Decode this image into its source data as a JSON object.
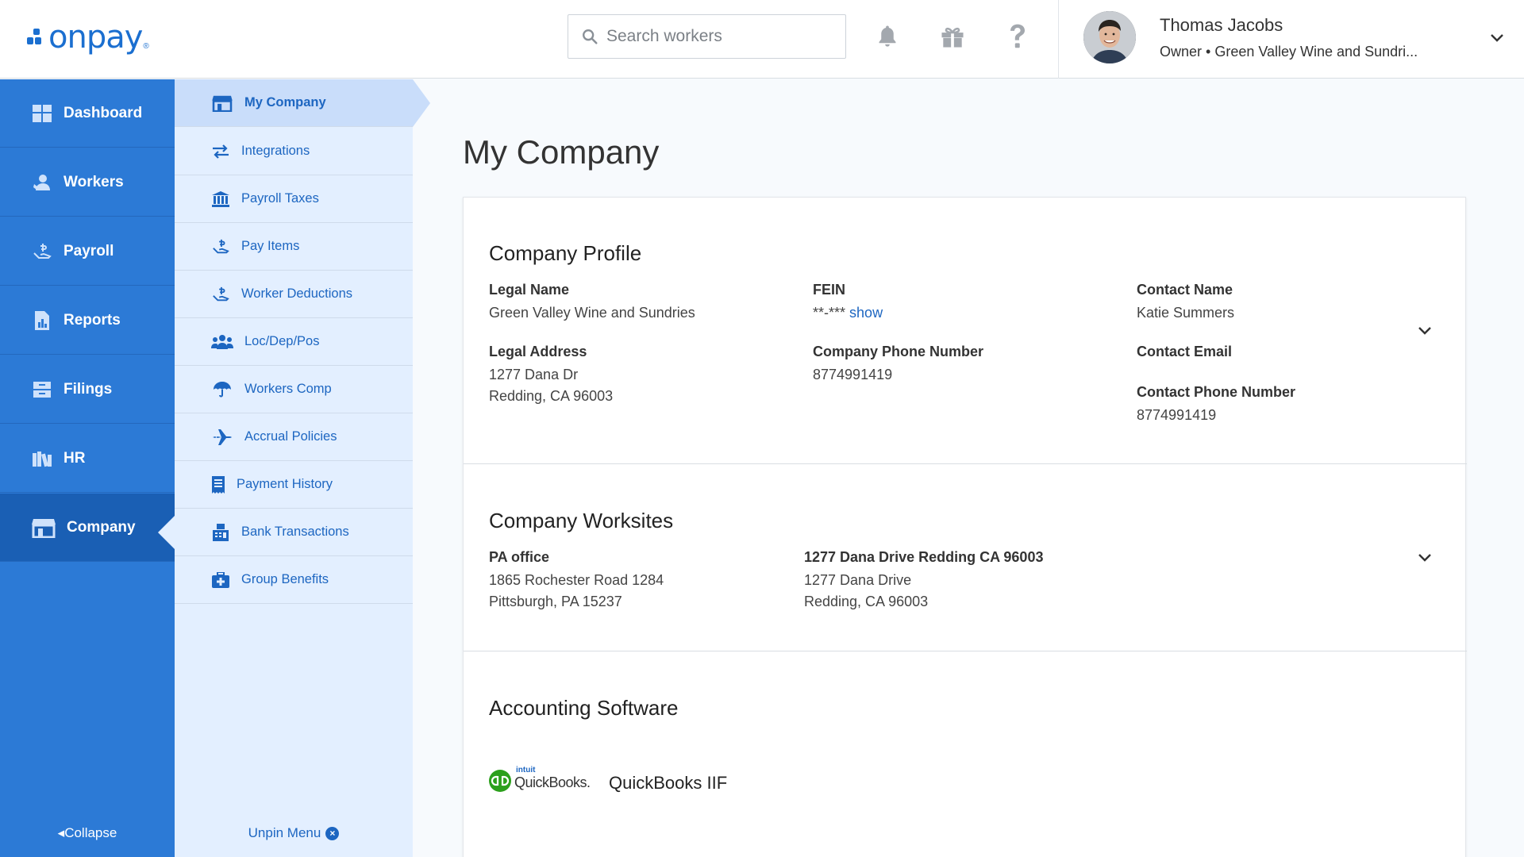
{
  "header": {
    "logo_text": "onpay",
    "logo_mark": "®",
    "search_placeholder": "Search workers",
    "user_name": "Thomas Jacobs",
    "user_subtitle": "Owner • Green Valley Wine and Sundri..."
  },
  "sidebar": {
    "items": [
      {
        "label": "Dashboard",
        "icon": "dashboard-icon"
      },
      {
        "label": "Workers",
        "icon": "workers-icon"
      },
      {
        "label": "Payroll",
        "icon": "payroll-icon"
      },
      {
        "label": "Reports",
        "icon": "reports-icon"
      },
      {
        "label": "Filings",
        "icon": "filings-icon"
      },
      {
        "label": "HR",
        "icon": "hr-icon"
      },
      {
        "label": "Company",
        "icon": "store-icon",
        "active": true
      }
    ],
    "collapse_label": "Collapse"
  },
  "subnav": {
    "items": [
      {
        "label": "My Company",
        "icon": "store-icon",
        "active": true
      },
      {
        "label": "Integrations",
        "icon": "swap-icon"
      },
      {
        "label": "Payroll Taxes",
        "icon": "bank-icon"
      },
      {
        "label": "Pay Items",
        "icon": "hand-money-icon"
      },
      {
        "label": "Worker Deductions",
        "icon": "hand-money-icon"
      },
      {
        "label": "Loc/Dep/Pos",
        "icon": "users-icon"
      },
      {
        "label": "Workers Comp",
        "icon": "umbrella-icon"
      },
      {
        "label": "Accrual Policies",
        "icon": "plane-icon"
      },
      {
        "label": "Payment History",
        "icon": "receipt-icon"
      },
      {
        "label": "Bank Transactions",
        "icon": "fax-icon"
      },
      {
        "label": "Group Benefits",
        "icon": "medkit-icon"
      }
    ],
    "unpin_label": "Unpin Menu"
  },
  "main": {
    "page_title": "My Company",
    "profile": {
      "title": "Company Profile",
      "legal_name_label": "Legal Name",
      "legal_name": "Green Valley Wine and Sundries",
      "legal_address_label": "Legal Address",
      "legal_address_line1": "1277 Dana Dr",
      "legal_address_line2": "Redding, CA 96003",
      "fein_label": "FEIN",
      "fein_masked": "**-***",
      "fein_show": "show",
      "company_phone_label": "Company Phone Number",
      "company_phone": "8774991419",
      "contact_name_label": "Contact Name",
      "contact_name": "Katie Summers",
      "contact_email_label": "Contact Email",
      "contact_phone_label": "Contact Phone Number",
      "contact_phone": "8774991419"
    },
    "worksites": {
      "title": "Company Worksites",
      "sites": [
        {
          "name": "PA office",
          "line1": "1865 Rochester Road 1284",
          "line2": "Pittsburgh, PA 15237"
        },
        {
          "name": "1277 Dana Drive Redding CA 96003",
          "line1": "1277 Dana Drive",
          "line2": "Redding, CA 96003"
        }
      ]
    },
    "accounting": {
      "title": "Accounting Software",
      "logo_brand_small": "intuit",
      "logo_brand": "QuickBooks.",
      "software_name": "QuickBooks IIF"
    }
  },
  "colors": {
    "primary_blue": "#2c7ad6",
    "active_blue": "#1a5fb4",
    "subnav_bg": "#e3efff",
    "link_blue": "#1d66c1",
    "quickbooks_green": "#2ca01c"
  }
}
